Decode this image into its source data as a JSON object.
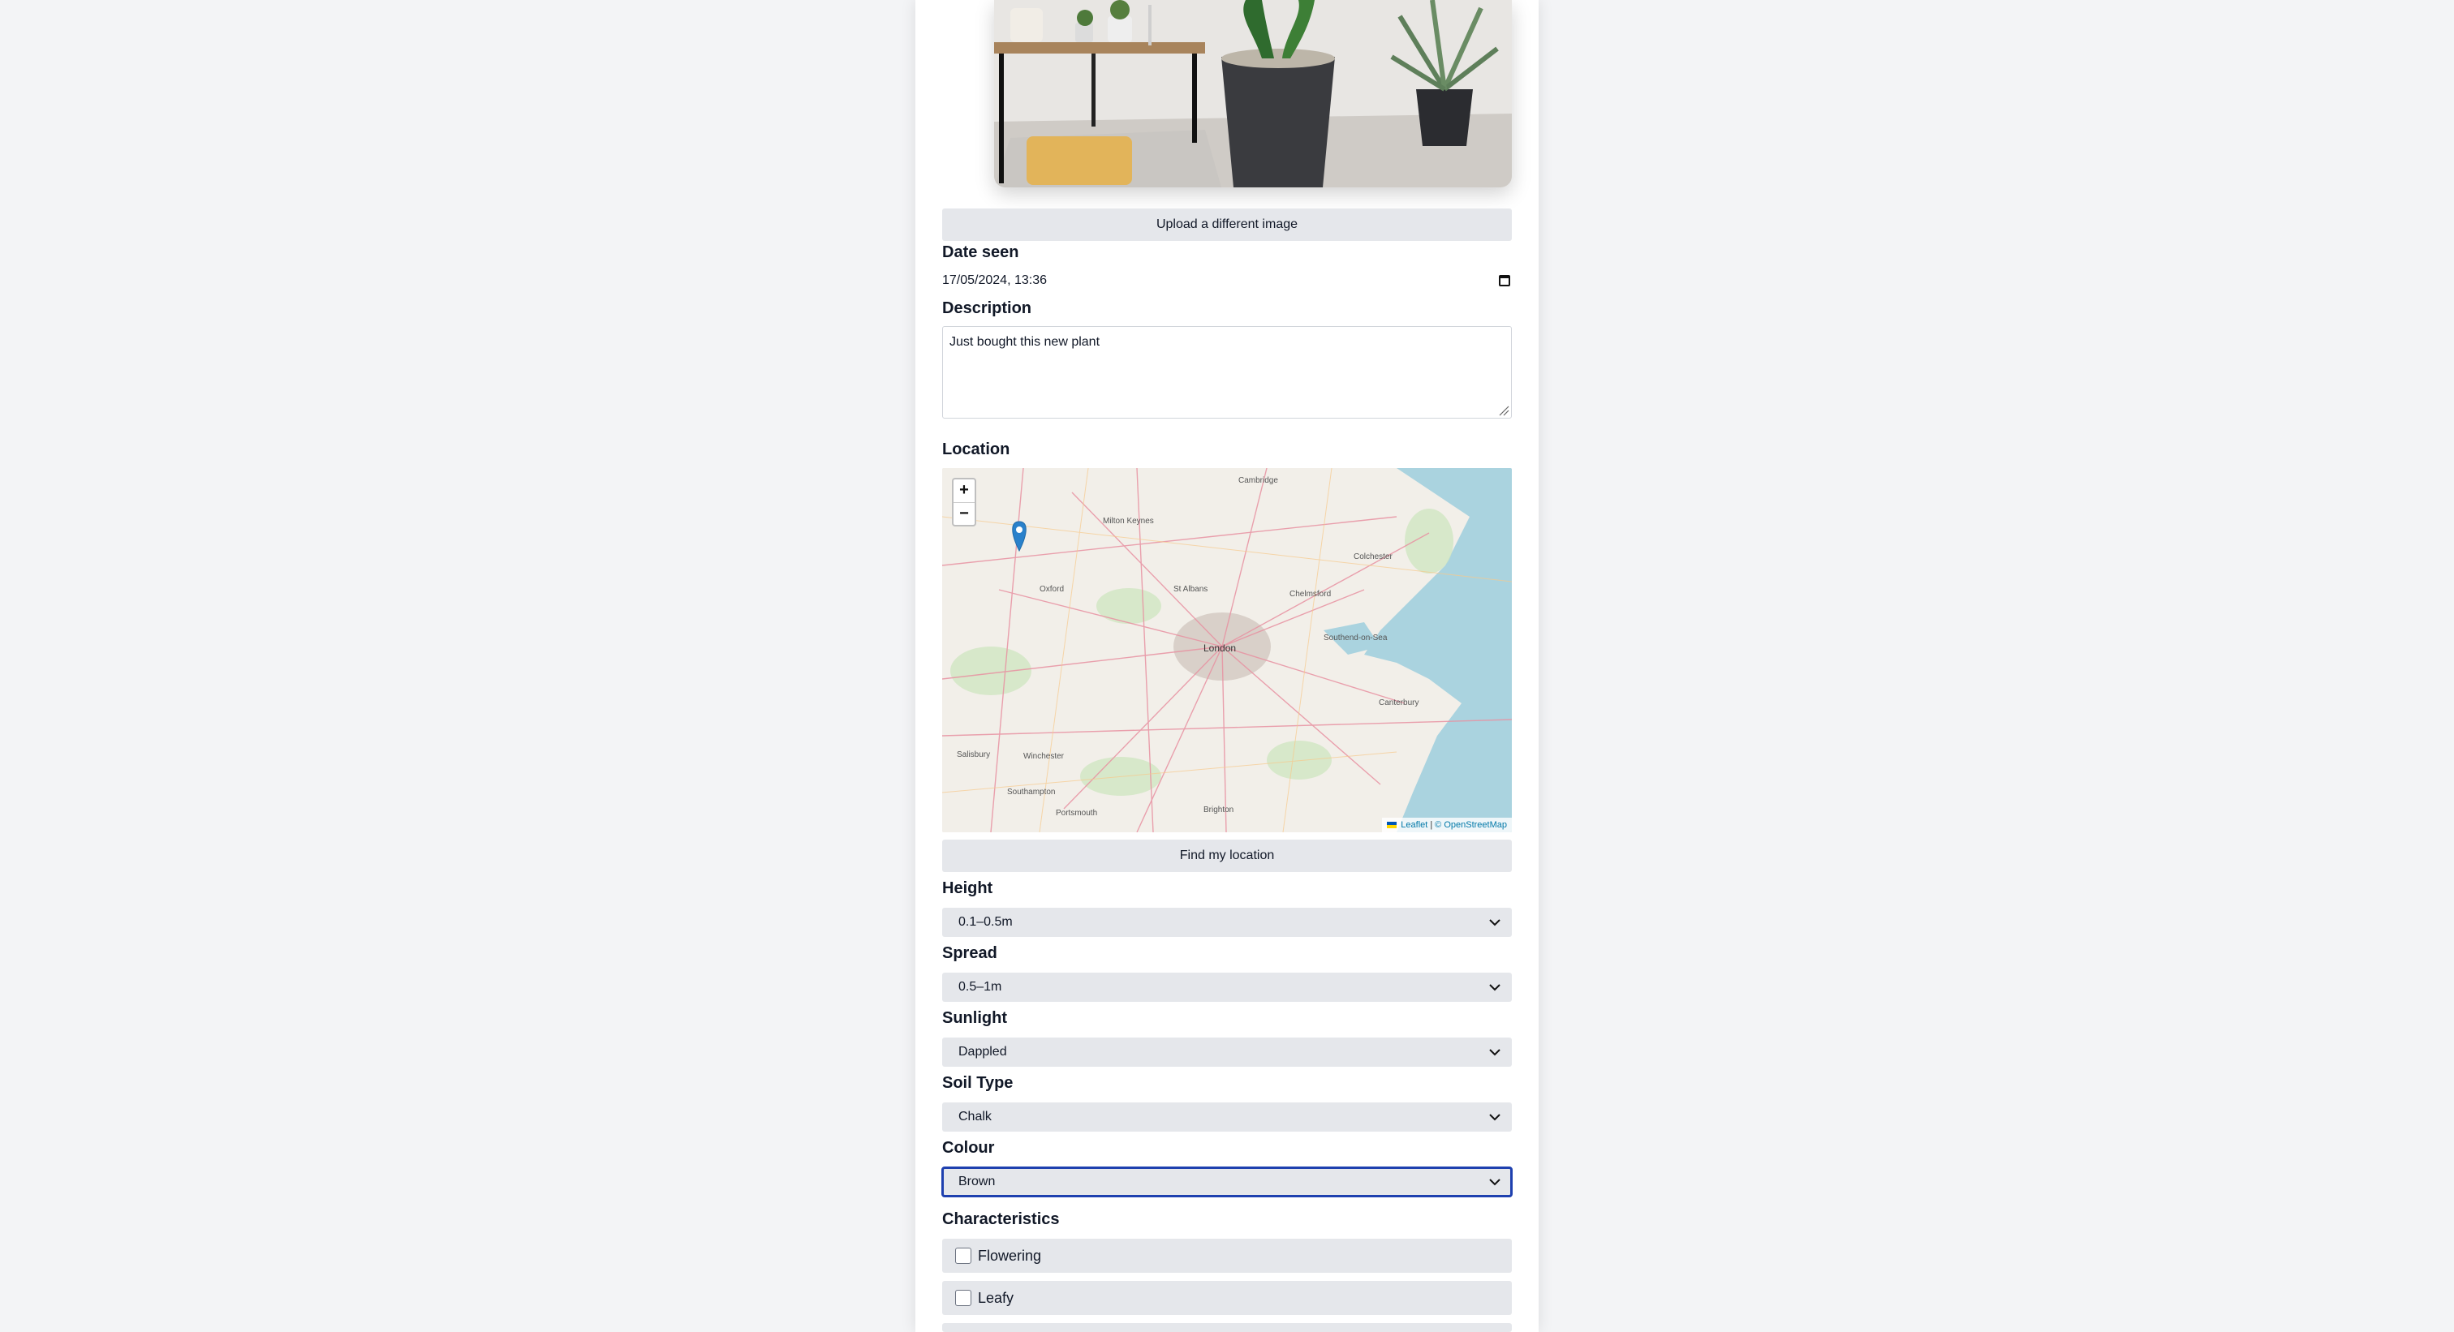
{
  "upload_button": "Upload a different image",
  "date_seen": {
    "label": "Date seen",
    "value": "17/05/2024, 13:36"
  },
  "description": {
    "label": "Description",
    "value": "Just bought this new plant"
  },
  "location": {
    "label": "Location",
    "zoom_in": "+",
    "zoom_out": "−",
    "attribution_leaflet": "Leaflet",
    "attribution_sep": "|",
    "attribution_osm": "© OpenStreetMap",
    "places": [
      "Cambridge",
      "Milton Keynes",
      "Colchester",
      "Oxford",
      "St Albans",
      "Chelmsford",
      "London",
      "Southend-on-Sea",
      "Canterbury",
      "Salisbury",
      "Winchester",
      "Southampton",
      "Portsmouth",
      "Brighton"
    ],
    "find_button": "Find my location",
    "marker_icon": "map-pin"
  },
  "fields": [
    {
      "label": "Height",
      "value": "0.1–0.5m"
    },
    {
      "label": "Spread",
      "value": "0.5–1m"
    },
    {
      "label": "Sunlight",
      "value": "Dappled"
    },
    {
      "label": "Soil Type",
      "value": "Chalk"
    },
    {
      "label": "Colour",
      "value": "Brown"
    }
  ],
  "characteristics": {
    "label": "Characteristics",
    "items": [
      {
        "label": "Flowering",
        "checked": false
      },
      {
        "label": "Leafy",
        "checked": false
      }
    ]
  },
  "colors": {
    "page_bg": "#f3f4f6",
    "control_bg": "#e5e7eb",
    "focus": "#1e40af",
    "water": "#aad3df",
    "land": "#f2efe9"
  }
}
